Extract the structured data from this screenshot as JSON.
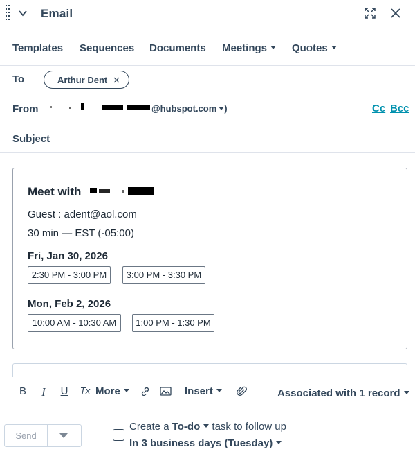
{
  "header": {
    "title": "Email",
    "icons": [
      "drag-handle-icon",
      "chevron-down-icon",
      "expand-icon",
      "close-icon"
    ]
  },
  "toolbar": {
    "templates": "Templates",
    "sequences": "Sequences",
    "documents": "Documents",
    "meetings": "Meetings",
    "quotes": "Quotes"
  },
  "to": {
    "label": "To",
    "recipient": "Arthur Dent"
  },
  "from": {
    "label": "From",
    "email_suffix": "@hubspot.com",
    "close_paren": ")",
    "cc": "Cc",
    "bcc": "Bcc"
  },
  "subject": {
    "label": "Subject",
    "value": ""
  },
  "meeting_card": {
    "title": "Meet with",
    "guest": "Guest : adent@aol.com",
    "duration": "30 min — EST (-05:00)",
    "days": [
      {
        "label": "Fri, Jan 30, 2026",
        "slots": [
          "2:30 PM - 3:00 PM",
          "3:00 PM - 3:30 PM"
        ]
      },
      {
        "label": "Mon, Feb 2, 2026",
        "slots": [
          "10:00 AM - 10:30 AM",
          "1:00 PM - 1:30 PM"
        ]
      }
    ]
  },
  "format_bar": {
    "bold": "B",
    "italic": "I",
    "underline": "U",
    "clear": "Tx",
    "more": "More",
    "insert": "Insert",
    "associated": "Associated with 1 record"
  },
  "footer": {
    "send": "Send",
    "todo_prefix": "Create a ",
    "todo_bold": "To-do",
    "todo_suffix": " task to follow up",
    "due": "In 3 business days (Tuesday)"
  },
  "colors": {
    "text": "#33475b",
    "link": "#0091ae",
    "border": "#dfe3eb"
  }
}
